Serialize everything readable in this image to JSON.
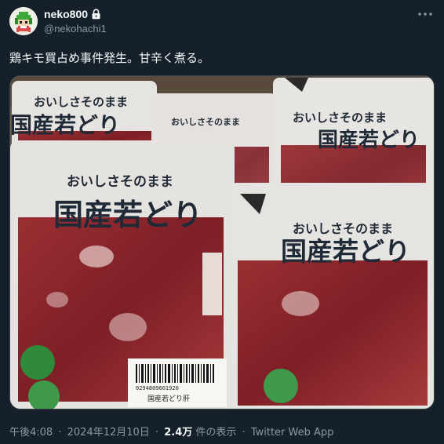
{
  "author": {
    "display_name": "neko800",
    "handle": "@nekohachi1",
    "avatar_icon": "pixel-character-avatar",
    "verified_lock_icon": "lock-icon"
  },
  "tweet": {
    "text": "鶏キモ買占め事件発生。甘辛く煮る。"
  },
  "media": {
    "package_label_top": "おいしさそのまま",
    "package_label_main": "国産若どり",
    "barcode_number": "0294809601920",
    "price_sticker_text": "国産若どり肝"
  },
  "meta": {
    "time": "午後4:08",
    "date": "2024年12月10日",
    "views": "2.4万",
    "views_label": "件の表示",
    "client": "Twitter Web App",
    "separator": "·"
  },
  "colors": {
    "background": "#15202b",
    "text_primary": "#f7f9f9",
    "text_secondary": "#8b98a5",
    "label_dark": "#1f2a36",
    "meat_red": "#8e2a2e"
  }
}
